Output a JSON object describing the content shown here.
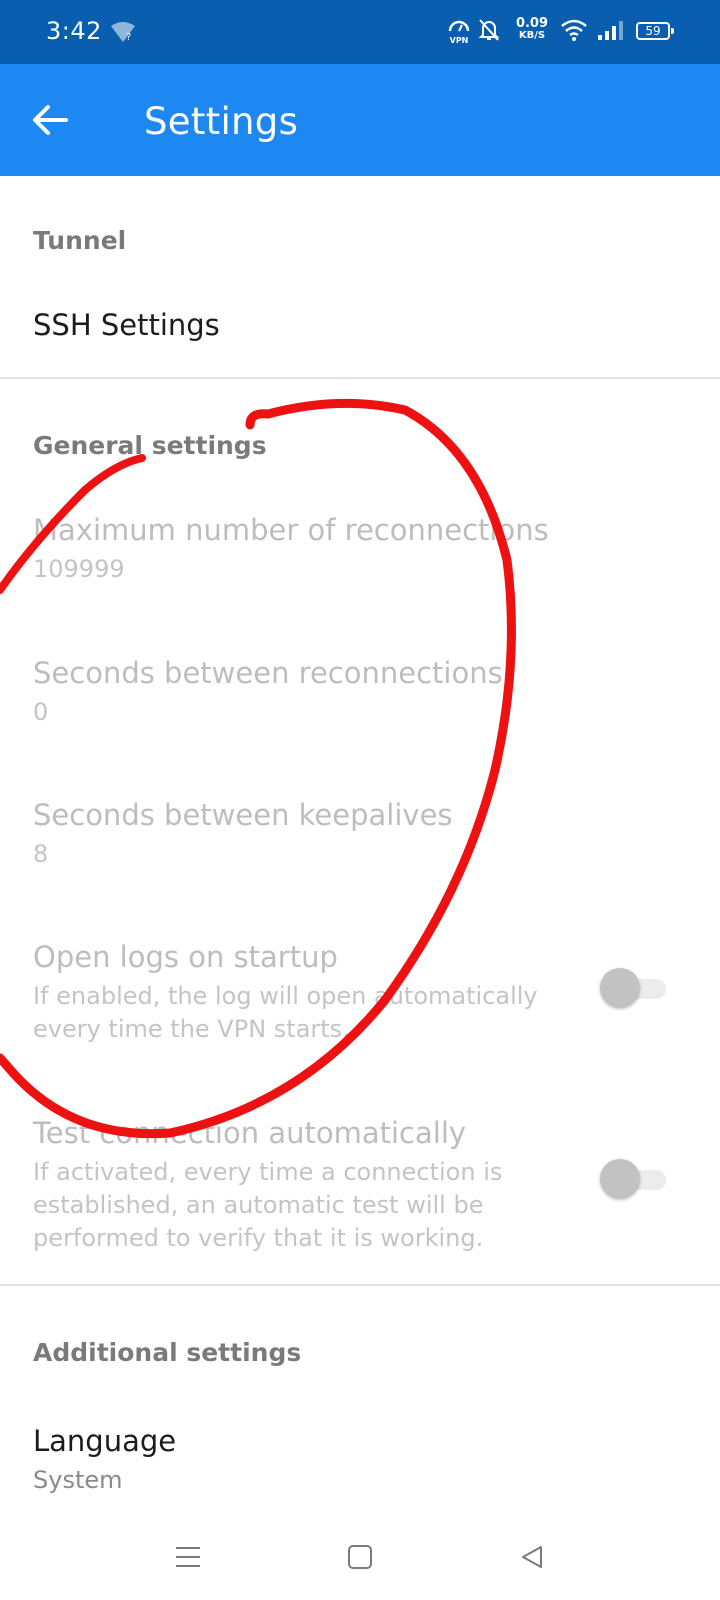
{
  "status_bar": {
    "time": "3:42",
    "speed_value": "0.09",
    "speed_unit": "KB/S",
    "battery": "59",
    "vpn_label": "VPN"
  },
  "app_bar": {
    "title": "Settings",
    "color": "#1e88f2"
  },
  "sections": {
    "tunnel": {
      "header": "Tunnel",
      "ssh_settings": "SSH Settings"
    },
    "general": {
      "header": "General settings",
      "max_reconnections_title": "Maximum number of reconnections",
      "max_reconnections_value": "109999",
      "seconds_reconnections_title": "Seconds between reconnections",
      "seconds_reconnections_value": "0",
      "seconds_keepalives_title": "Seconds between keepalives",
      "seconds_keepalives_value": "8",
      "open_logs_title": "Open logs on startup",
      "open_logs_summary_1": "If enabled, the log will open automatically",
      "open_logs_summary_2": "every time the VPN starts.",
      "open_logs_enabled": false,
      "test_connection_title": "Test connection automatically",
      "test_connection_summary_1": "If activated, every time a connection is",
      "test_connection_summary_2": "established, an automatic test will be",
      "test_connection_summary_3": "performed to verify that it is working.",
      "test_connection_enabled": false
    },
    "additional": {
      "header": "Additional settings",
      "language_title": "Language",
      "language_value": "System"
    }
  },
  "annotation_color": "#ee1111",
  "icons": {
    "back": "arrow-left-icon",
    "nav_recents": "menu-lines-icon",
    "nav_home": "square-icon",
    "nav_back": "triangle-back-icon"
  }
}
